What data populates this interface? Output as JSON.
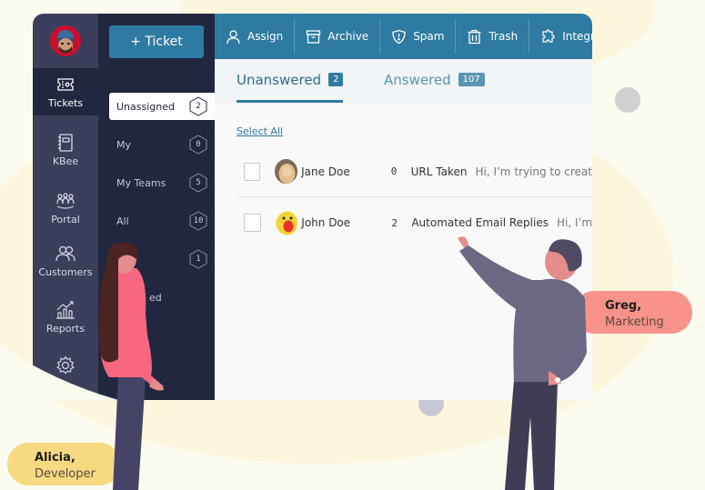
{
  "rail": {
    "items": [
      {
        "label": "Tickets",
        "icon": "ticket-icon",
        "active": true
      },
      {
        "label": "KBee",
        "icon": "notebook-icon",
        "active": false
      },
      {
        "label": "Portal",
        "icon": "users-group-icon",
        "active": false
      },
      {
        "label": "Customers",
        "icon": "customers-icon",
        "active": false
      },
      {
        "label": "Reports",
        "icon": "chart-icon",
        "active": false
      },
      {
        "label": "",
        "icon": "gear-icon",
        "active": false
      }
    ]
  },
  "panel": {
    "new_ticket_label": "+ Ticket",
    "folders": [
      {
        "label": "Unassigned",
        "count": "2",
        "active": true
      },
      {
        "label": "My",
        "count": "0"
      },
      {
        "label": "My Teams",
        "count": "5"
      },
      {
        "label": "All",
        "count": "10"
      },
      {
        "label": "",
        "count": "1"
      },
      {
        "label": "ed",
        "count": ""
      }
    ]
  },
  "toolbar": {
    "actions": [
      {
        "label": "Assign",
        "icon": "user-icon"
      },
      {
        "label": "Archive",
        "icon": "archive-icon"
      },
      {
        "label": "Spam",
        "icon": "shield-icon"
      },
      {
        "label": "Trash",
        "icon": "trash-icon"
      },
      {
        "label": "Integrat",
        "icon": "puzzle-icon"
      }
    ]
  },
  "tabs": [
    {
      "label": "Unanswered",
      "count": "2",
      "active": true
    },
    {
      "label": "Answered",
      "count": "107",
      "active": false
    }
  ],
  "select_all_label": "Select All",
  "tickets": [
    {
      "name": "Jane Doe",
      "count": "0",
      "subject": "URL Taken",
      "preview": "Hi, I’m trying to creat"
    },
    {
      "name": "John Doe",
      "count": "2",
      "subject": "Automated Email Replies",
      "preview": "Hi, I’m"
    }
  ],
  "bubbles": {
    "greg": {
      "name": "Greg,",
      "role": "Marketing",
      "color": "#f8928a"
    },
    "alicia": {
      "name": "Alicia,",
      "role": "Developer",
      "color": "#f7d982"
    }
  },
  "colors": {
    "rail": "#3c3f5c",
    "panel": "#20273f",
    "accent": "#2e7aa1",
    "background": "#fbfbef"
  }
}
